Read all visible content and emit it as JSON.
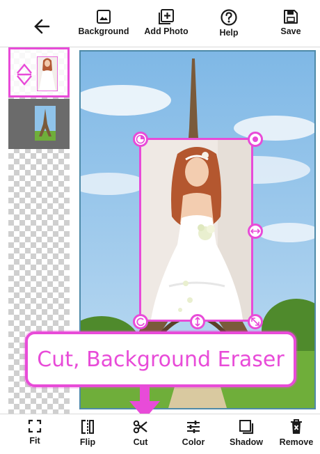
{
  "toolbar": {
    "back_icon": "arrow-left-icon",
    "items": [
      {
        "label": "Background",
        "icon": "image-icon"
      },
      {
        "label": "Add Photo",
        "icon": "add-photo-icon"
      },
      {
        "label": "Help",
        "icon": "help-icon"
      },
      {
        "label": "Save",
        "icon": "save-icon"
      }
    ]
  },
  "layers": [
    {
      "name": "girl-photo-layer",
      "selected": true
    },
    {
      "name": "eiffel-tower-layer",
      "selected": false
    }
  ],
  "callout": {
    "text": "Cut, Background Eraser"
  },
  "bottom_toolbar": {
    "items": [
      {
        "label": "Fit",
        "icon": "fit-icon"
      },
      {
        "label": "Flip",
        "icon": "flip-icon"
      },
      {
        "label": "Cut",
        "icon": "scissors-icon"
      },
      {
        "label": "Color",
        "icon": "color-sliders-icon"
      },
      {
        "label": "Shadow",
        "icon": "shadow-icon"
      },
      {
        "label": "Remove",
        "icon": "trash-icon"
      }
    ]
  },
  "colors": {
    "accent": "#e84bd8",
    "sky": "#8fc3ea",
    "grass": "#6fae3a",
    "tower": "#7a5a3a",
    "text": "#1a1a1a"
  }
}
